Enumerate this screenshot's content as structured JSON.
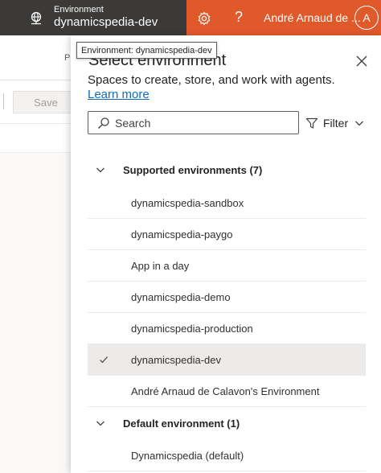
{
  "topbar": {
    "environment_label": "Environment",
    "environment_name": "dynamicspedia-dev",
    "user_name": "André Arnaud de ...",
    "avatar_initial": "A",
    "help_glyph": "?",
    "icons": [
      "globe-icon",
      "gear-icon",
      "help-icon"
    ],
    "colors": {
      "bar": "#e0592a",
      "env_switch": "#3b3a39"
    }
  },
  "background": {
    "save_label": "Save",
    "partial_text": "P"
  },
  "tooltip": {
    "text": "Environment: dynamicspedia-dev"
  },
  "panel": {
    "title": "Select environment",
    "description": "Spaces to create, store, and work with agents.",
    "learn_more": "Learn more",
    "search": {
      "placeholder": "Search",
      "value": ""
    },
    "filter_label": "Filter",
    "groups": [
      {
        "label": "Supported environments (7)",
        "expanded": true,
        "items": [
          {
            "label": "dynamicspedia-sandbox",
            "selected": false
          },
          {
            "label": "dynamicspedia-paygo",
            "selected": false
          },
          {
            "label": "App in a day",
            "selected": false
          },
          {
            "label": "dynamicspedia-demo",
            "selected": false
          },
          {
            "label": "dynamicspedia-production",
            "selected": false
          },
          {
            "label": "dynamicspedia-dev",
            "selected": true
          },
          {
            "label": "André Arnaud de Calavon's Environment",
            "selected": false
          }
        ]
      },
      {
        "label": "Default environment (1)",
        "expanded": true,
        "items": [
          {
            "label": "Dynamicspedia (default)",
            "selected": false
          }
        ]
      }
    ],
    "colors": {
      "selected_row": "#edebe9",
      "link": "#0f6cbd"
    }
  }
}
